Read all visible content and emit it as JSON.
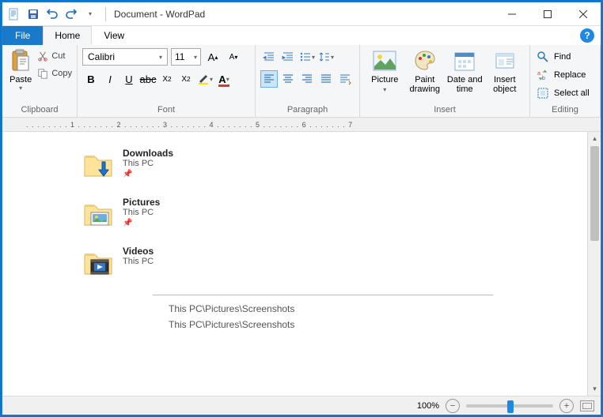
{
  "title": "Document - WordPad",
  "tabs": {
    "file": "File",
    "home": "Home",
    "view": "View"
  },
  "clipboard": {
    "paste": "Paste",
    "cut": "Cut",
    "copy": "Copy",
    "label": "Clipboard"
  },
  "font": {
    "name": "Calibri",
    "size": "11",
    "label": "Font"
  },
  "paragraph": {
    "label": "Paragraph"
  },
  "insert": {
    "picture": "Picture",
    "paint": "Paint drawing",
    "datetime": "Date and time",
    "object": "Insert object",
    "label": "Insert"
  },
  "editing": {
    "find": "Find",
    "replace": "Replace",
    "selectall": "Select all",
    "label": "Editing"
  },
  "ruler_text": ". . . . . . . . 1 . . . . . . . 2 . . . . . . . 3 . . . . . . . 4 . . . . . . . 5 . . . . . . . 6 . . . . . . . 7",
  "doc": {
    "items": [
      {
        "name": "Downloads",
        "loc": "This PC",
        "pinned": true
      },
      {
        "name": "Pictures",
        "loc": "This PC",
        "pinned": true
      },
      {
        "name": "Videos",
        "loc": "This PC",
        "pinned": false
      }
    ],
    "path1": "This PC\\Pictures\\Screenshots",
    "path2": "This PC\\Pictures\\Screenshots"
  },
  "status": {
    "zoom": "100%"
  }
}
